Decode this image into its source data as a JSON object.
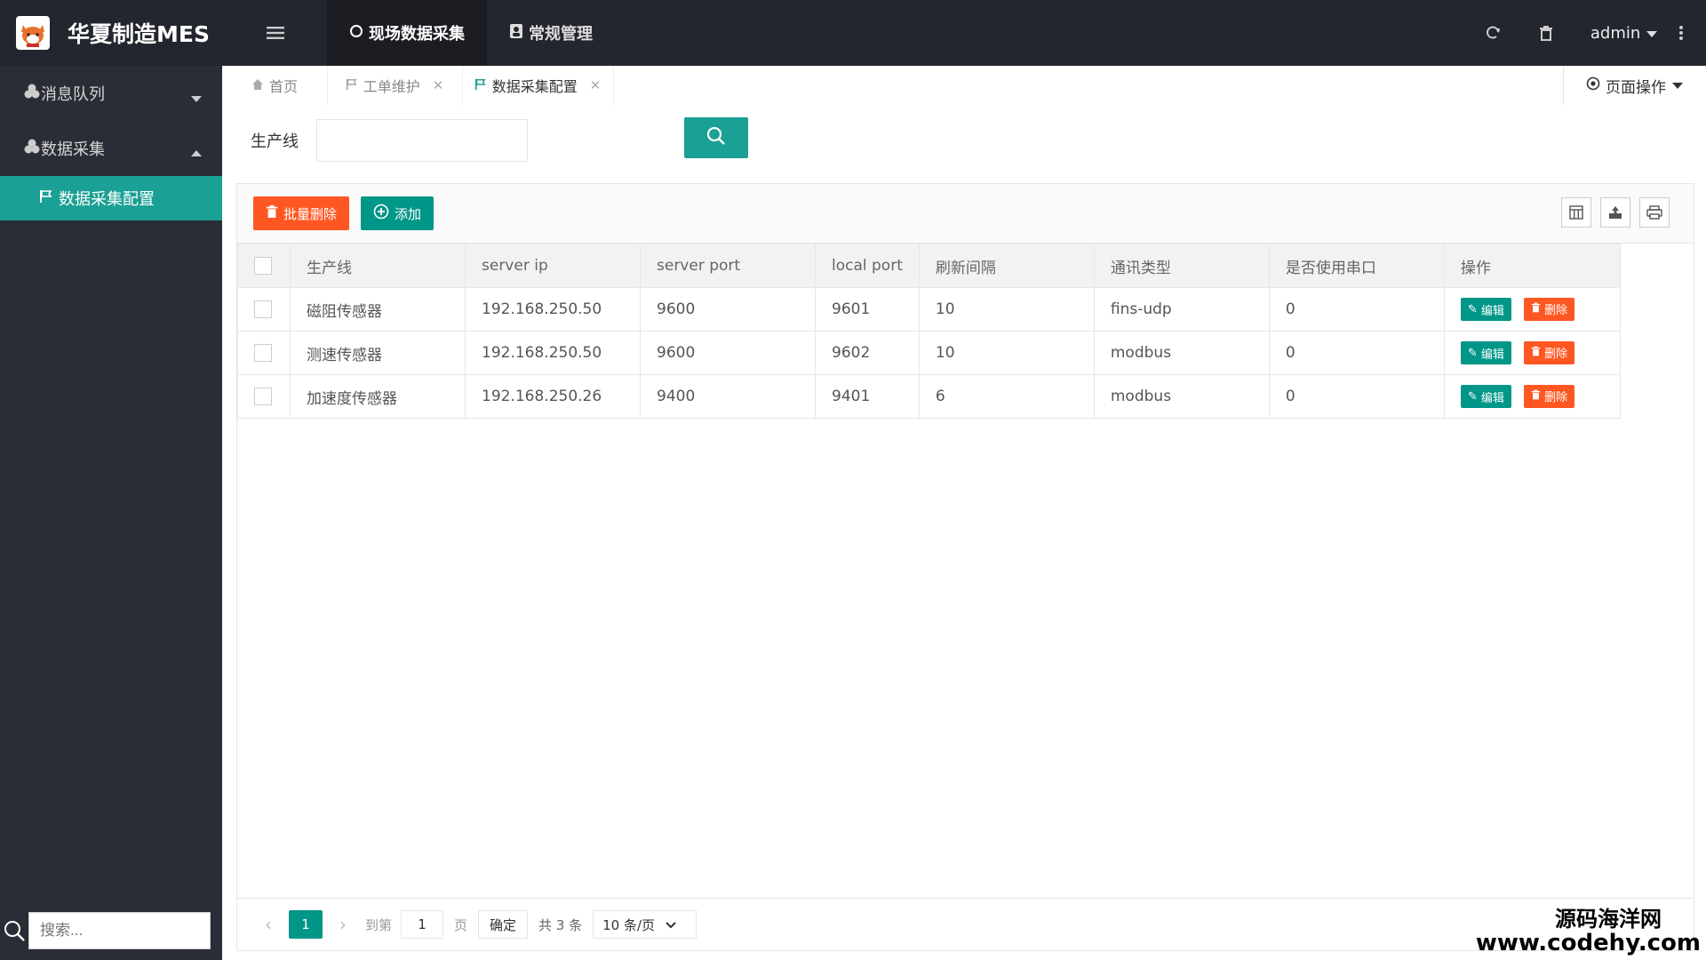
{
  "app": {
    "title": "华夏制造MES"
  },
  "colors": {
    "accent": "#1aa094",
    "primary": "#009688",
    "danger": "#ff5722",
    "header_bg": "#23262e",
    "sidebar_bg": "#2a2d35"
  },
  "top_nav": [
    {
      "label": "现场数据采集",
      "icon": "circle-icon",
      "active": true
    },
    {
      "label": "常规管理",
      "icon": "contact-icon",
      "active": false
    }
  ],
  "header": {
    "user": "admin"
  },
  "sidebar": {
    "groups": [
      {
        "label": "消息队列",
        "icon": "cubes-icon",
        "expanded": false
      },
      {
        "label": "数据采集",
        "icon": "cubes-icon",
        "expanded": true
      }
    ],
    "sub_items": [
      {
        "label": "数据采集配置",
        "icon": "flag-icon",
        "active": true
      }
    ],
    "search_placeholder": "搜索..."
  },
  "tabs": [
    {
      "label": "首页",
      "icon": "home-icon"
    },
    {
      "label": "工单维护",
      "icon": "flag-icon"
    },
    {
      "label": "数据采集配置",
      "icon": "flag-icon",
      "active": true
    }
  ],
  "page_ops": "页面操作",
  "filter": {
    "label": "生产线",
    "value": ""
  },
  "toolbar": {
    "batch_delete": "批量删除",
    "add": "添加"
  },
  "table": {
    "columns": [
      "生产线",
      "server ip",
      "server port",
      "local port",
      "刷新间隔",
      "通讯类型",
      "是否使用串口",
      "操作"
    ],
    "rows": [
      {
        "line": "磁阻传感器",
        "ip": "192.168.250.50",
        "server_port": "9600",
        "local_port": "9601",
        "interval": "10",
        "type": "fins-udp",
        "serial": "0"
      },
      {
        "line": "测速传感器",
        "ip": "192.168.250.50",
        "server_port": "9600",
        "local_port": "9602",
        "interval": "10",
        "type": "modbus",
        "serial": "0"
      },
      {
        "line": "加速度传感器",
        "ip": "192.168.250.26",
        "server_port": "9400",
        "local_port": "9401",
        "interval": "6",
        "type": "modbus",
        "serial": "0"
      }
    ],
    "row_actions": {
      "edit": "编辑",
      "delete": "删除"
    }
  },
  "pager": {
    "current": "1",
    "goto_label": "到第",
    "goto_value": "1",
    "page_label": "页",
    "ok": "确定",
    "total": "共 3 条",
    "page_size": "10 条/页"
  },
  "watermark": {
    "line1": "源码海洋网",
    "line2": "www.codehy.com"
  }
}
